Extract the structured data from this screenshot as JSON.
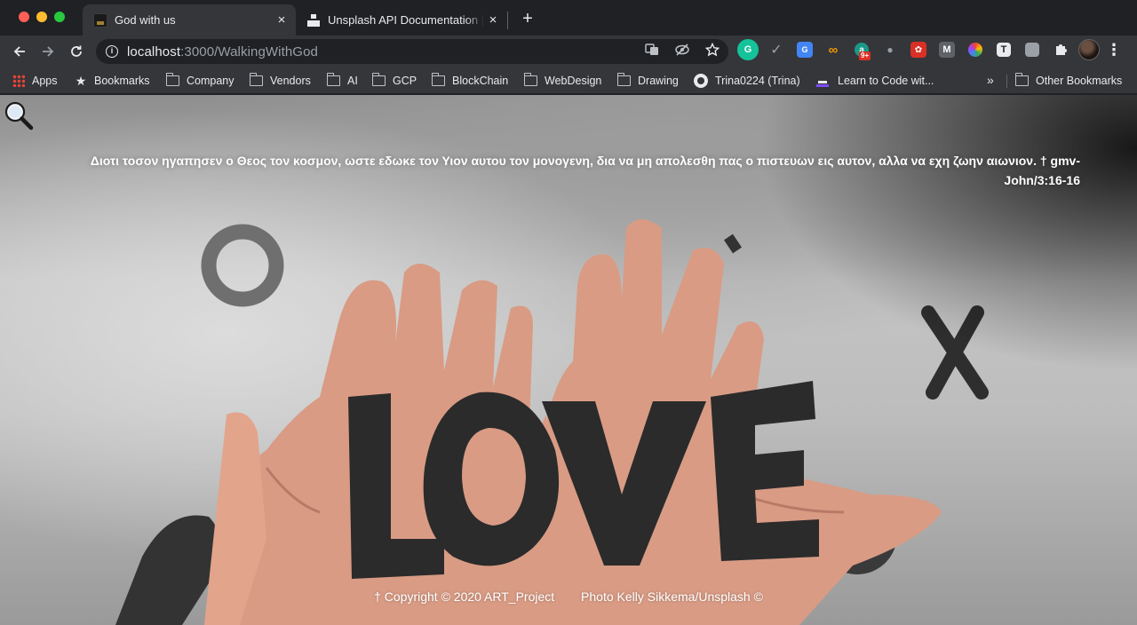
{
  "browser": {
    "tabs": [
      {
        "title": "God with us",
        "active": true
      },
      {
        "title": "Unsplash API Documentation | ",
        "active": false
      }
    ],
    "new_tab_symbol": "+",
    "close_symbol": "×",
    "url_host": "localhost",
    "url_path": ":3000/WalkingWithGod",
    "extension_badge": "9+",
    "extensions": [
      "grammarly-icon",
      "check-icon",
      "google-translate-icon",
      "loop-icon",
      "a-extension-icon",
      "dot-icon",
      "red-extension-icon",
      "m-extension-icon",
      "color-wheel-icon",
      "t-extension-icon",
      "square-extension-icon",
      "puzzle-icon",
      "profile-avatar",
      "menu-icon"
    ]
  },
  "bookmarks": {
    "items": [
      {
        "label": "Apps",
        "icon": "apps-grid-icon"
      },
      {
        "label": "Bookmarks",
        "icon": "star-icon"
      },
      {
        "label": "Company",
        "icon": "folder-icon"
      },
      {
        "label": "Vendors",
        "icon": "folder-icon"
      },
      {
        "label": "AI",
        "icon": "folder-icon"
      },
      {
        "label": "GCP",
        "icon": "folder-icon"
      },
      {
        "label": "BlockChain",
        "icon": "folder-icon"
      },
      {
        "label": "WebDesign",
        "icon": "folder-icon"
      },
      {
        "label": "Drawing",
        "icon": "folder-icon"
      },
      {
        "label": "Trina0224 (Trina)",
        "icon": "github-icon"
      },
      {
        "label": "Learn to Code wit...",
        "icon": "code-icon"
      }
    ],
    "more_symbol": "»",
    "other_label": "Other Bookmarks"
  },
  "page": {
    "verse": "Διοτι τοσον ηγαπησεν ο Θεος τον κοσμον, ωστε εδωκε τον Υιον αυτου τον μονογενη, δια να μη απολεσθη πας ο πιστευων εις αυτον, αλλα να εχη ζωην αιωνιον. † gmv-John/3:16-16",
    "copyright": "† Copyright © 2020 ART_Project",
    "photo_credit": "Photo Kelly Sikkema/Unsplash ©",
    "art_text": "LOVE"
  }
}
